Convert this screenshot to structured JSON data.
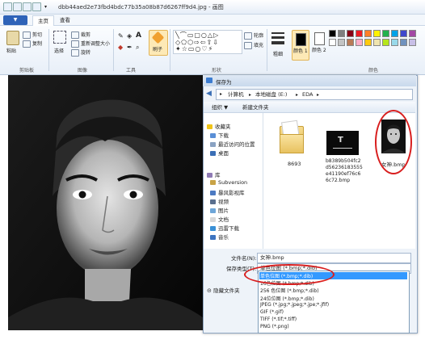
{
  "window": {
    "title": "dbb44aed2e73fbd4bdc77b35a08b87d6267ff9d4.jpg - 画图"
  },
  "ribbon": {
    "file_label": "▼",
    "tabs": [
      "主页",
      "查看"
    ],
    "clipboard": {
      "paste": "粘贴",
      "cut": "剪切",
      "copy": "复制",
      "group": "剪贴板"
    },
    "image": {
      "crop": "裁剪",
      "resize": "重新调整大小",
      "select": "选择",
      "rotate": "旋转",
      "group": "图像"
    },
    "tools": {
      "group": "工具"
    },
    "brushes": {
      "label": "刷子"
    },
    "shapes": {
      "outline": "轮廓",
      "fill": "填充",
      "group": "形状"
    },
    "size": {
      "label": "粗细"
    },
    "color1": "颜色 1",
    "color2": "颜色 2",
    "colors_group": "颜色",
    "palette": [
      "#000000",
      "#7f7f7f",
      "#880015",
      "#ed1c24",
      "#ff7f27",
      "#fff200",
      "#22b14c",
      "#00a2e8",
      "#3f48cc",
      "#a349a4",
      "#ffffff",
      "#c3c3c3",
      "#b97a57",
      "#ffaec9",
      "#ffc90e",
      "#efe4b0",
      "#b5e61d",
      "#99d9ea",
      "#7092be",
      "#c8bfe7"
    ]
  },
  "dialog": {
    "title": "保存为",
    "path": [
      "计算机",
      "本地磁盘 (E:)",
      "EDA"
    ],
    "organize": "组织 ▼",
    "new_folder": "新建文件夹",
    "nav": {
      "favorites": "收藏夹",
      "downloads": "下载",
      "recent": "最近访问的位置",
      "desktop": "桌面",
      "library": "库",
      "subversion": "Subversion",
      "baofeng": "暴风影视库",
      "videos": "视频",
      "pictures": "图片",
      "documents": "文档",
      "xunlei": "迅雷下载",
      "music": "音乐"
    },
    "files": [
      {
        "name": "8693"
      },
      {
        "name": "b8389b504fc2d56236183555e41190ef76c66c72.bmp"
      },
      {
        "name": "女神.bmp"
      }
    ],
    "filename_label": "文件名(N):",
    "filename_value": "女神.bmp",
    "savetype_label": "保存类型(T):",
    "savetype_value": "单色位图 (*.bmp;*.dib)",
    "hide_folders": "隐藏文件夹",
    "types": [
      "单色位图 (*.bmp;*.dib)",
      "16色位图 (*.bmp;*.dib)",
      "256 色位图 (*.bmp;*.dib)",
      "24位位图 (*.bmp;*.dib)",
      "JPEG (*.jpg;*.jpeg;*.jpe;*.jfif)",
      "GIF (*.gif)",
      "TIFF (*.tif;*.tiff)",
      "PNG (*.png)"
    ],
    "selected_type_index": 0
  }
}
